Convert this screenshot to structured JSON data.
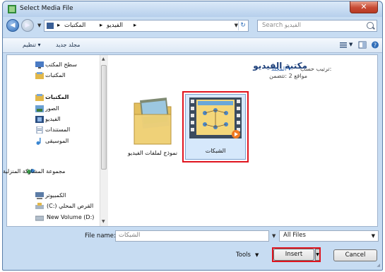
{
  "window": {
    "title": "Select Media File",
    "close_label": "✕"
  },
  "address": {
    "crumbs": [
      "المكتبات",
      "الفيديو"
    ],
    "search_placeholder": "Search الفيديو"
  },
  "toolbar": {
    "organize_label": "تنظيم ▾",
    "new_folder_label": "مجلد جديد"
  },
  "nav": {
    "items": [
      {
        "label": "سطح المكتب"
      },
      {
        "label": "المكتبات"
      },
      {
        "label": "المكتبات"
      },
      {
        "label": "الصور"
      },
      {
        "label": "الفيديو"
      },
      {
        "label": "المستندات"
      },
      {
        "label": "الموسيقى"
      },
      {
        "label": "مجموعة المشاركة المنزلية"
      },
      {
        "label": "الكمبيوتر"
      },
      {
        "label": "(C:) القرص المحلي"
      },
      {
        "label": "New Volume (D:)"
      }
    ]
  },
  "main": {
    "library_title": "مكتبة الفيديو",
    "library_sub": "مواقع 2 :تتضمن",
    "arrange_label": "ترتيب حسب:",
    "arrange_value": "المجلد ▾",
    "files": [
      {
        "label": "نموذج لملفات الفيديو"
      },
      {
        "label": "الشبكات"
      }
    ]
  },
  "bottom": {
    "filename_label": "File name:",
    "filename_value": "الشبكات",
    "filter_value": "All Files",
    "tools_label": "Tools",
    "insert_label": "Insert",
    "cancel_label": "Cancel"
  },
  "colors": {
    "highlight_red": "#e0141e",
    "title_blue": "#1c3f7a",
    "close_red": "#c74a33"
  }
}
